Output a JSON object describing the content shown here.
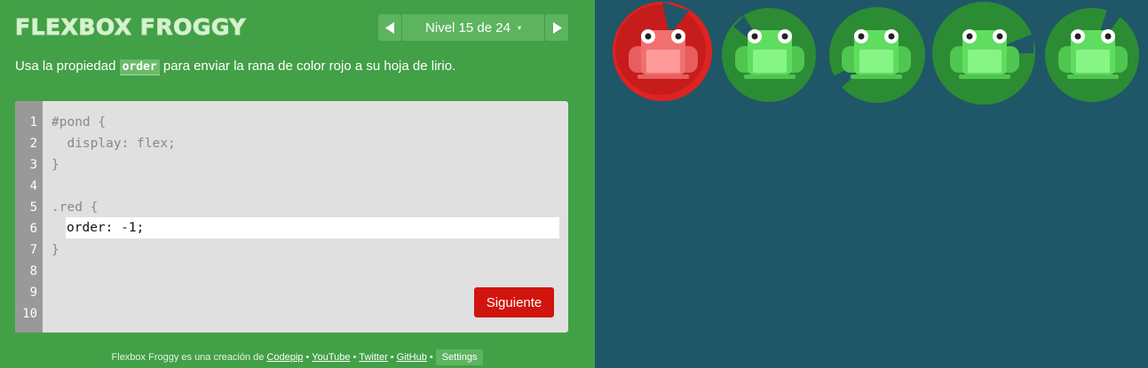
{
  "header": {
    "title": "FLEXBOX FROGGY",
    "level_label": "Nivel 15 de 24",
    "caret": "▾"
  },
  "instructions": {
    "before": "Usa la propiedad ",
    "code": "order",
    "after": " para enviar la rana de color rojo a su hoja de lirio."
  },
  "editor": {
    "line_numbers": [
      "1",
      "2",
      "3",
      "4",
      "5",
      "6",
      "7",
      "8",
      "9",
      "10"
    ],
    "lines": [
      "#pond {",
      "  display: flex;",
      "}",
      "",
      ".red {",
      "",
      "}"
    ],
    "input_value": "order: -1;",
    "next_button": "Siguiente"
  },
  "footer": {
    "text": "Flexbox Froggy es una creación de ",
    "links": [
      "Codepip",
      "YouTube",
      "Twitter",
      "GitHub"
    ],
    "separator": "•",
    "settings": "Settings"
  },
  "pond": {
    "frogs": [
      {
        "color": "red",
        "icon": "frog-icon"
      },
      {
        "color": "green",
        "icon": "frog-icon"
      },
      {
        "color": "green",
        "icon": "frog-icon"
      },
      {
        "color": "green",
        "icon": "frog-icon"
      },
      {
        "color": "green",
        "icon": "frog-icon"
      }
    ],
    "lilypads": [
      {
        "color": "red",
        "icon": "lilypad-icon"
      },
      {
        "color": "green",
        "icon": "lilypad-icon"
      },
      {
        "color": "green",
        "icon": "lilypad-icon"
      },
      {
        "color": "green",
        "icon": "lilypad-icon"
      },
      {
        "color": "green",
        "icon": "lilypad-icon"
      }
    ]
  },
  "colors": {
    "sidebar_bg": "#42a047",
    "pond_bg": "#1f5768",
    "accent_button": "#d1140d",
    "red_lilypad": "#e02222",
    "green_lilypad": "#2c8c33",
    "red_frog": "#ff6b6b",
    "green_frog": "#5fdd5f"
  }
}
